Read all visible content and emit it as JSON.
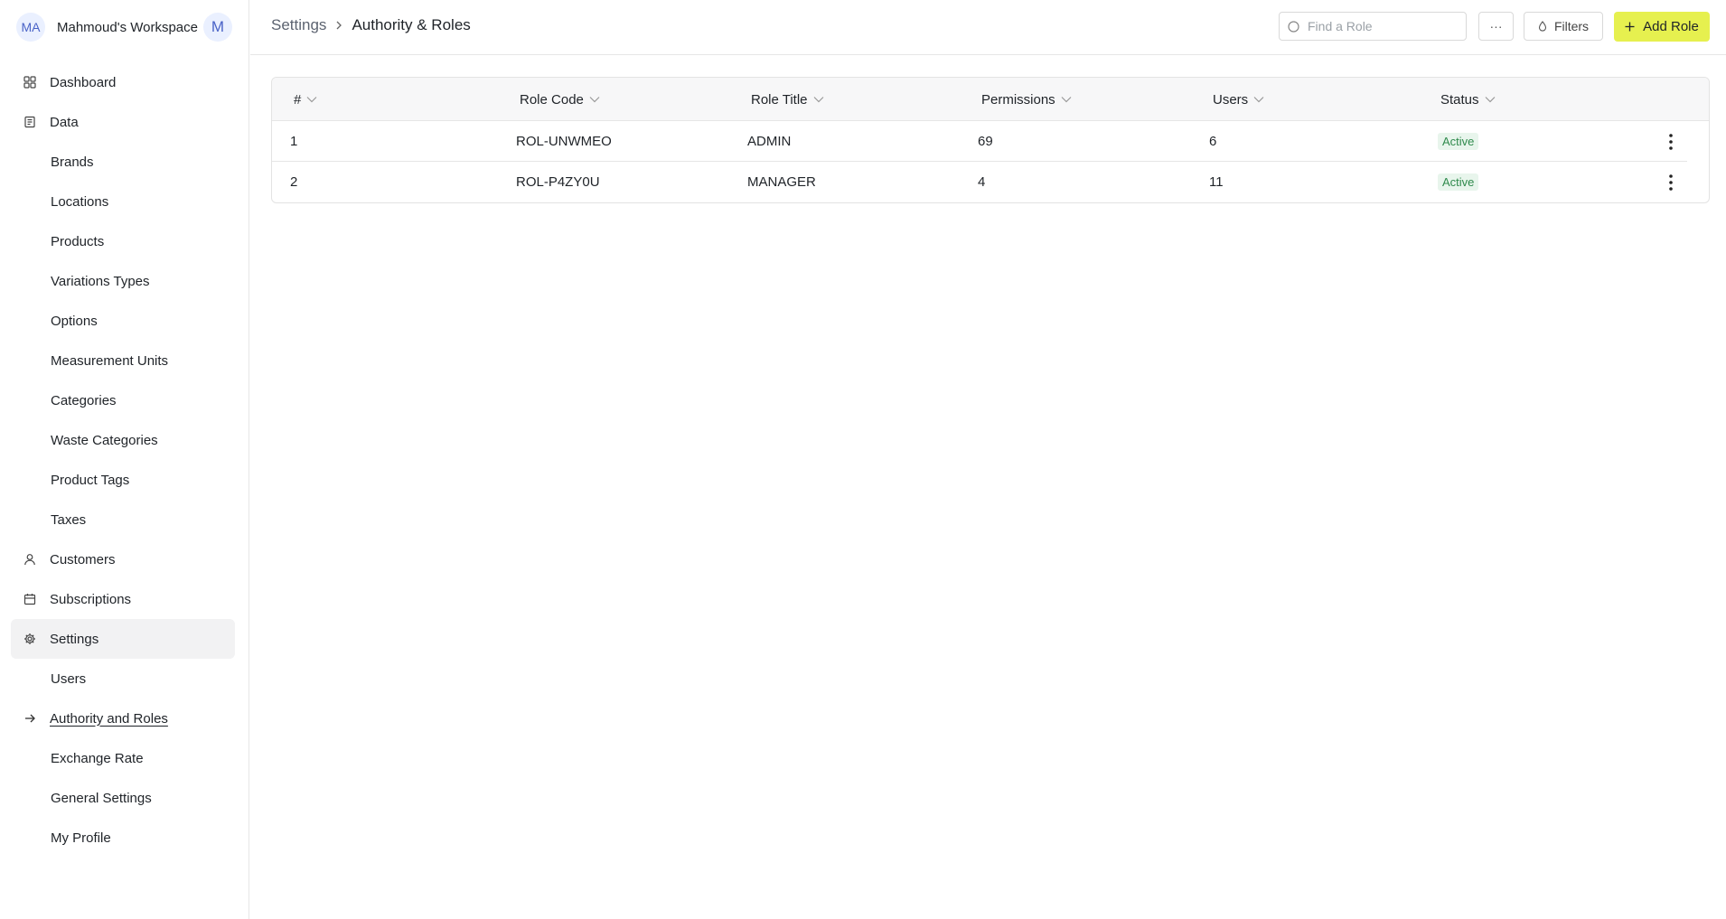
{
  "workspace": {
    "avatar_initials": "MA",
    "name": "Mahmoud's Workspace",
    "user_initial": "M"
  },
  "sidebar": {
    "items": [
      {
        "label": "Dashboard",
        "icon": "grid-icon",
        "level": 0
      },
      {
        "label": "Data",
        "icon": "database-icon",
        "level": 0
      },
      {
        "label": "Brands",
        "level": 1
      },
      {
        "label": "Locations",
        "level": 1
      },
      {
        "label": "Products",
        "level": 1
      },
      {
        "label": "Variations Types",
        "level": 1
      },
      {
        "label": "Options",
        "level": 1
      },
      {
        "label": "Measurement Units",
        "level": 1
      },
      {
        "label": "Categories",
        "level": 1
      },
      {
        "label": "Waste Categories",
        "level": 1
      },
      {
        "label": "Product Tags",
        "level": 1
      },
      {
        "label": "Taxes",
        "level": 1
      },
      {
        "label": "Customers",
        "icon": "user-icon",
        "level": 0
      },
      {
        "label": "Subscriptions",
        "icon": "calendar-icon",
        "level": 0
      },
      {
        "label": "Settings",
        "icon": "gear-icon",
        "level": 0,
        "active": true
      },
      {
        "label": "Users",
        "level": 1
      },
      {
        "label": "Authority and Roles",
        "level": 1,
        "current": true
      },
      {
        "label": "Exchange Rate",
        "level": 1
      },
      {
        "label": "General Settings",
        "level": 1
      },
      {
        "label": "My Profile",
        "level": 1
      }
    ]
  },
  "header": {
    "breadcrumb": [
      "Settings",
      "Authority & Roles"
    ],
    "search_placeholder": "Find a Role",
    "more_label": "···",
    "filters_label": "Filters",
    "add_label": "Add Role"
  },
  "table": {
    "columns": [
      "#",
      "Role Code",
      "Role Title",
      "Permissions",
      "Users",
      "Status"
    ],
    "rows": [
      {
        "index": "1",
        "code": "ROL-UNWMEO",
        "title": "ADMIN",
        "permissions": "69",
        "users": "6",
        "status": "Active"
      },
      {
        "index": "2",
        "code": "ROL-P4ZY0U",
        "title": "MANAGER",
        "permissions": "4",
        "users": "11",
        "status": "Active"
      }
    ]
  },
  "colors": {
    "accent": "#e6f04f",
    "active_badge_bg": "#e8f5ec",
    "active_badge_text": "#2f8a4c"
  }
}
